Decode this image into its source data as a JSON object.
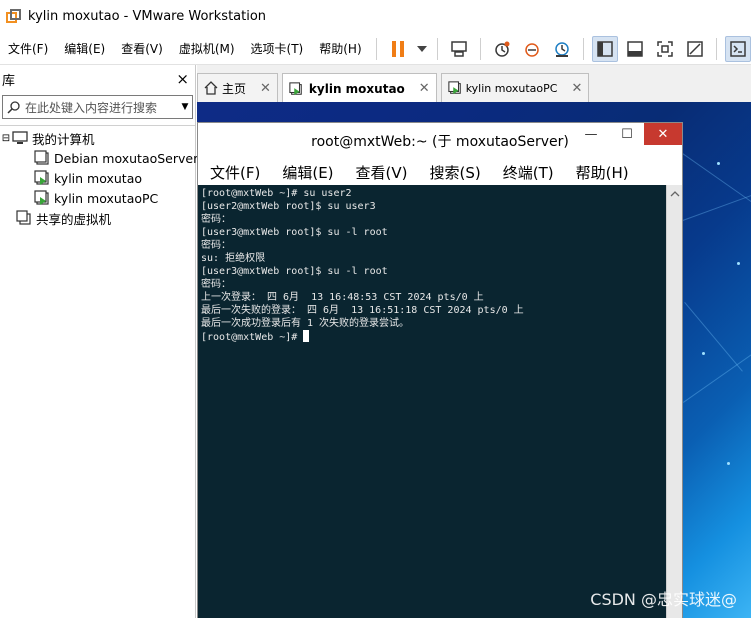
{
  "window": {
    "title": "kylin moxutao - VMware Workstation"
  },
  "menubar": {
    "items": [
      "文件(F)",
      "编辑(E)",
      "查看(V)",
      "虚拟机(M)",
      "选项卡(T)",
      "帮助(H)"
    ]
  },
  "toolbar": {
    "icons": [
      "pause-icon",
      "dropdown-icon",
      "send-keys-icon",
      "snapshot-icon",
      "revert-snapshot-icon",
      "snapshot-manager-icon",
      "library-view-icon",
      "thumbnail-view-icon",
      "fullscreen-icon",
      "unity-icon",
      "console-icon"
    ]
  },
  "library": {
    "title": "库",
    "close": "×",
    "search_placeholder": "在此处键入内容进行搜索",
    "tree": [
      {
        "label": "我的计算机",
        "level": 0,
        "icon": "computer-icon"
      },
      {
        "label": "Debian moxutaoServer",
        "level": 1,
        "icon": "vm-icon"
      },
      {
        "label": "kylin moxutao",
        "level": 1,
        "icon": "vm-running-icon"
      },
      {
        "label": "kylin moxutaoPC",
        "level": 1,
        "icon": "vm-running-icon"
      },
      {
        "label": "共享的虚拟机",
        "level": 0,
        "icon": "shared-vms-icon"
      }
    ]
  },
  "tabs": [
    {
      "label": "主页",
      "icon": "home-icon",
      "active": false
    },
    {
      "label": "kylin moxutao",
      "icon": "vm-running-icon",
      "active": true
    },
    {
      "label": "kylin moxutaoPC",
      "icon": "vm-running-icon",
      "active": false
    }
  ],
  "terminal": {
    "title": "root@mxtWeb:~ (于 moxutaoServer)",
    "menu": [
      "文件(F)",
      "编辑(E)",
      "查看(V)",
      "搜索(S)",
      "终端(T)",
      "帮助(H)"
    ],
    "lines": [
      "[root@mxtWeb ~]# su user2",
      "[user2@mxtWeb root]$ su user3",
      "密码：",
      "[user3@mxtWeb root]$ su -l root",
      "密码：",
      "su: 拒绝权限",
      "[user3@mxtWeb root]$ su -l root",
      "密码：",
      "上一次登录： 四 6月  13 16:48:53 CST 2024 pts/0 上",
      "最后一次失败的登录： 四 6月  13 16:51:18 CST 2024 pts/0 上",
      "最后一次成功登录后有 1 次失败的登录尝试。"
    ],
    "prompt": "[root@mxtWeb ~]# "
  },
  "watermark": "CSDN @忠实球迷@",
  "colors": {
    "accent": "#0063b1",
    "terminal_bg": "#0a2530",
    "close_red": "#c7392f"
  }
}
